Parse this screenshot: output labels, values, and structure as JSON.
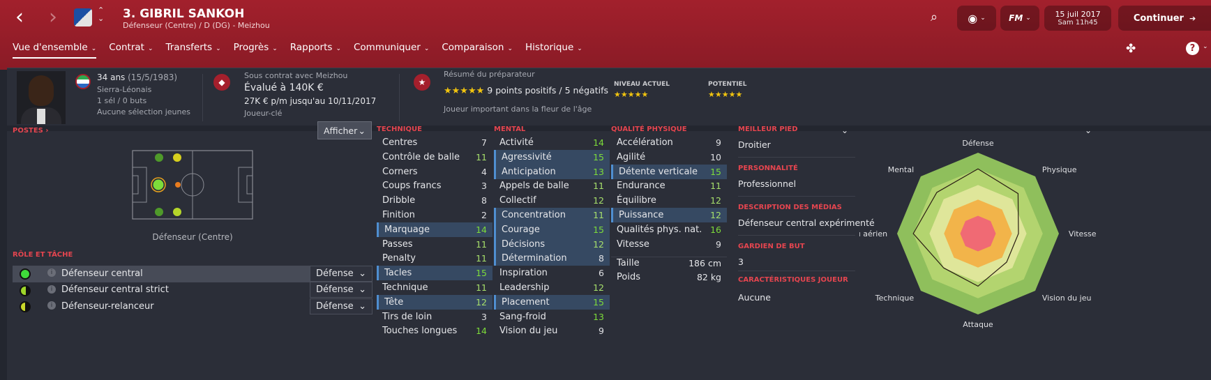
{
  "header": {
    "back_icon": "chevron-left-icon",
    "forward_icon": "chevron-right-icon",
    "club_crest_icon": "club-crest-icon",
    "name": "3. GIBRIL SANKOH",
    "subtitle": "Défenseur (Centre) / D (DG) - Meizhou",
    "date": "15 juil 2017",
    "time": "Sam 11h45",
    "continue_label": "Continuer"
  },
  "tabs": [
    {
      "label": "Vue d'ensemble"
    },
    {
      "label": "Contrat"
    },
    {
      "label": "Transferts"
    },
    {
      "label": "Progrès"
    },
    {
      "label": "Rapports"
    },
    {
      "label": "Communiquer"
    },
    {
      "label": "Comparaison"
    },
    {
      "label": "Historique"
    }
  ],
  "info": {
    "age": "34 ans",
    "dob": "(15/5/1983)",
    "nationality": "Sierra-Léonais",
    "caps": "1 sél / 0 buts",
    "youth": "Aucune sélection jeunes",
    "contract_with": "Sous contrat avec Meizhou",
    "value": "Évalué à 140K €",
    "wage": "27K € p/m jusqu'au 10/11/2017",
    "status": "Joueur-clé",
    "coach_title": "Résumé du préparateur",
    "coach_points": "9 points positifs / 5 négatifs",
    "coach_note": "Joueur important dans la fleur de l'âge",
    "current_label": "NIVEAU ACTUEL",
    "potential_label": "POTENTIEL",
    "stars": "★★★★★"
  },
  "positions": {
    "title": "POSTES",
    "show_btn": "Afficher",
    "pitch_label": "Défenseur (Centre)"
  },
  "roles": {
    "title": "RÔLE ET TÂCHE",
    "items": [
      {
        "name": "Défenseur central",
        "duty": "Défense"
      },
      {
        "name": "Défenseur central strict",
        "duty": "Défense"
      },
      {
        "name": "Défenseur-relanceur",
        "duty": "Défense"
      }
    ]
  },
  "technique": {
    "title": "TECHNIQUE",
    "items": [
      {
        "n": "Centres",
        "v": "7"
      },
      {
        "n": "Contrôle de balle",
        "v": "11"
      },
      {
        "n": "Corners",
        "v": "4"
      },
      {
        "n": "Coups francs",
        "v": "3"
      },
      {
        "n": "Dribble",
        "v": "8"
      },
      {
        "n": "Finition",
        "v": "2"
      },
      {
        "n": "Marquage",
        "v": "14",
        "h": 1
      },
      {
        "n": "Passes",
        "v": "11"
      },
      {
        "n": "Penalty",
        "v": "11"
      },
      {
        "n": "Tacles",
        "v": "15",
        "h": 1
      },
      {
        "n": "Technique",
        "v": "11"
      },
      {
        "n": "Tête",
        "v": "12",
        "h": 1
      },
      {
        "n": "Tirs de loin",
        "v": "3"
      },
      {
        "n": "Touches longues",
        "v": "14"
      }
    ]
  },
  "mental": {
    "title": "MENTAL",
    "items": [
      {
        "n": "Activité",
        "v": "14"
      },
      {
        "n": "Agressivité",
        "v": "15",
        "h": 1
      },
      {
        "n": "Anticipation",
        "v": "13",
        "h": 1
      },
      {
        "n": "Appels de balle",
        "v": "11"
      },
      {
        "n": "Collectif",
        "v": "12"
      },
      {
        "n": "Concentration",
        "v": "11",
        "h": 1
      },
      {
        "n": "Courage",
        "v": "15",
        "h": 1
      },
      {
        "n": "Décisions",
        "v": "12",
        "h": 1
      },
      {
        "n": "Détermination",
        "v": "8",
        "h": 1
      },
      {
        "n": "Inspiration",
        "v": "6"
      },
      {
        "n": "Leadership",
        "v": "12"
      },
      {
        "n": "Placement",
        "v": "15",
        "h": 1
      },
      {
        "n": "Sang-froid",
        "v": "13"
      },
      {
        "n": "Vision du jeu",
        "v": "9"
      }
    ]
  },
  "physical": {
    "title": "QUALITÉ PHYSIQUE",
    "items": [
      {
        "n": "Accélération",
        "v": "9"
      },
      {
        "n": "Agilité",
        "v": "10"
      },
      {
        "n": "Détente verticale",
        "v": "15",
        "h": 1
      },
      {
        "n": "Endurance",
        "v": "11"
      },
      {
        "n": "Équilibre",
        "v": "12"
      },
      {
        "n": "Puissance",
        "v": "12",
        "h": 1
      },
      {
        "n": "Qualités phys. nat.",
        "v": "16"
      },
      {
        "n": "Vitesse",
        "v": "9"
      }
    ],
    "height_label": "Taille",
    "height": "186 cm",
    "weight_label": "Poids",
    "weight": "82 kg"
  },
  "profile": {
    "foot_label": "MEILLEUR PIED",
    "foot": "Droitier",
    "personality_label": "PERSONNALITÉ",
    "personality": "Professionnel",
    "media_label": "DESCRIPTION DES MÉDIAS",
    "media": "Défenseur central expérimenté",
    "gk_label": "GARDIEN DE BUT",
    "gk": "3",
    "traits_label": "CARACTÉRISTIQUES JOUEUR",
    "traits": "Aucune"
  },
  "radar": {
    "labels": [
      "Défense",
      "Physique",
      "Vitesse",
      "Vision du jeu",
      "Attaque",
      "Technique",
      "Jeu aérien",
      "Mental"
    ],
    "values": [
      0.8,
      0.7,
      0.5,
      0.5,
      0.65,
      0.6,
      0.8,
      0.72
    ]
  },
  "colors": {
    "header": "#9e1f2b",
    "accent": "#e5454f",
    "green": "#7ddc3a",
    "highlight": "#364962"
  }
}
